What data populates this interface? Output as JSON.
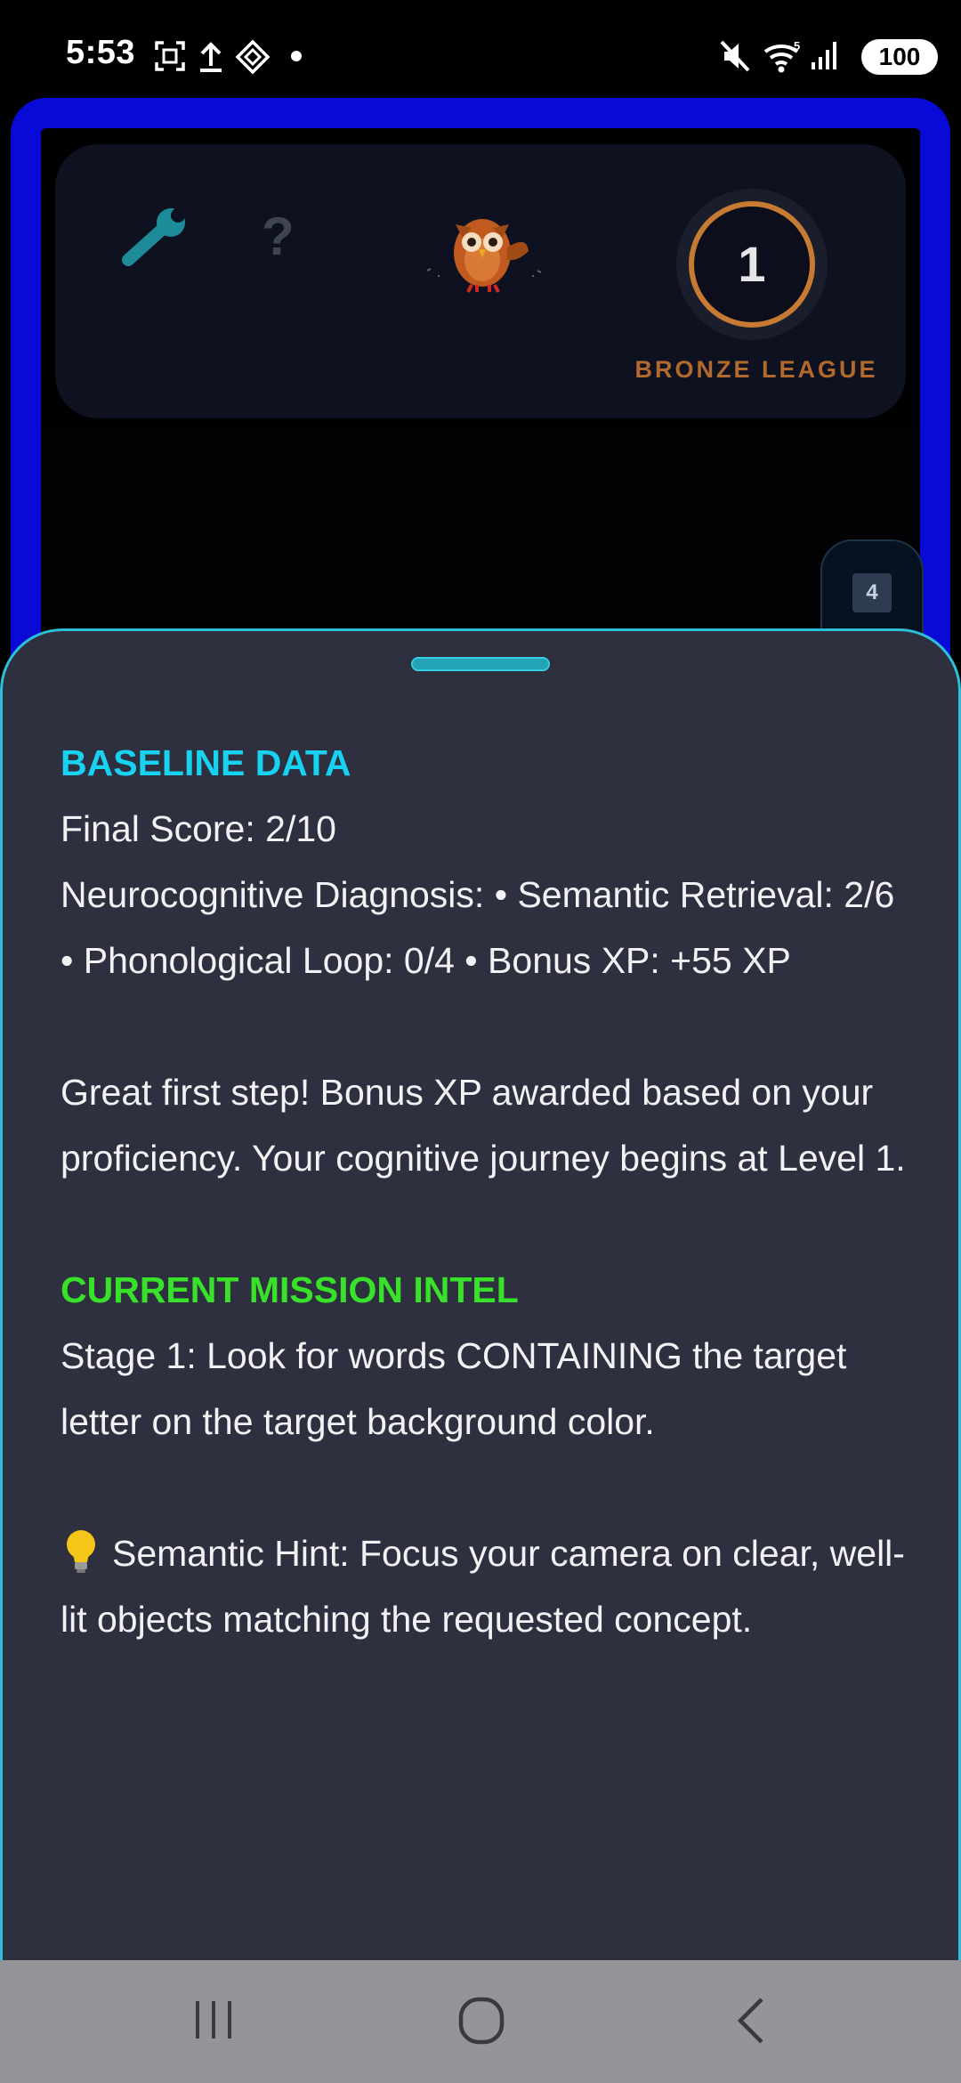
{
  "status_bar": {
    "time": "5:53",
    "icons": [
      "screenshot-icon",
      "upload-icon",
      "app-icon",
      "dot-icon",
      "mute-icon",
      "wifi-icon",
      "signal-icon"
    ],
    "battery": "100"
  },
  "header": {
    "icons": [
      "wrench-icon",
      "help-icon",
      "owl-mascot"
    ],
    "level": "1",
    "league_label": "BRONZE LEAGUE",
    "side_badge": "4"
  },
  "sheet": {
    "baseline_heading": "BASELINE DATA",
    "final_score": "Final Score: 2/10",
    "diagnosis": "Neurocognitive Diagnosis: • Semantic Retrieval: 2/6 • Phonological Loop: 0/4 • Bonus XP: +55 XP",
    "message": "Great first step! Bonus XP awarded based on your proficiency. Your cognitive journey begins at Level 1.",
    "mission_heading": "CURRENT MISSION INTEL",
    "stage": "Stage 1: Look for words CONTAINING the target letter on the target background color.",
    "hint": "Semantic Hint: Focus your camera on clear, well-lit objects matching the requested concept."
  },
  "colors": {
    "accent_cyan": "#18d2f2",
    "accent_green": "#39e22a",
    "frame_blue": "#0a0ad6",
    "bronze": "#c77a32"
  }
}
